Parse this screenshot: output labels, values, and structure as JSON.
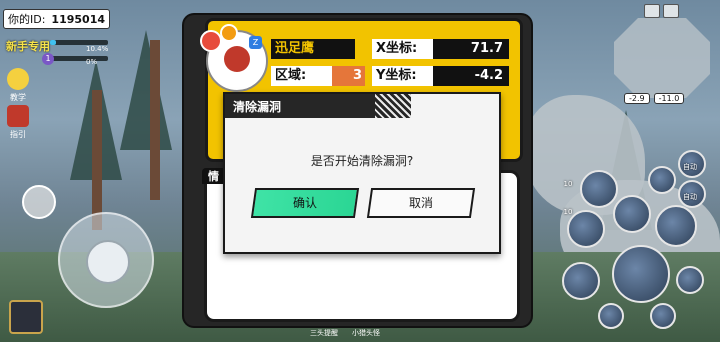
{
  "player": {
    "id_label": "你的ID:",
    "id_value": "1195014",
    "newbie_tag": "新手专用",
    "level": "1",
    "bar1_label": "10.4%",
    "bar2_label": "0%"
  },
  "side_menu": {
    "teach_label": "教学",
    "guide_label": "指引"
  },
  "target": {
    "name": "迅足鹰",
    "region_label": "区域:",
    "region_value": "3",
    "x_label": "X坐标:",
    "x_value": "71.7",
    "y_label": "Y坐标:",
    "y_value": "-4.2",
    "level_badge": "Z",
    "section_tab": "情"
  },
  "dialog": {
    "title": "清除漏洞",
    "message": "是否开始清除漏洞?",
    "confirm_label": "确认",
    "cancel_label": "取消"
  },
  "minimap": {
    "coord_x": "-2.9",
    "coord_y": "-11.0"
  },
  "skills": {
    "auto1_label": "自动",
    "auto2_label": "自动",
    "skill_level_a": "10",
    "skill_level_b": "10"
  },
  "bottom_bar": {
    "label1": "三头提醒",
    "label2": "小猎头怪"
  },
  "colors": {
    "panel_yellow": "#f2c300",
    "confirm_green": "#2bd694",
    "region_orange": "#e5763a"
  }
}
